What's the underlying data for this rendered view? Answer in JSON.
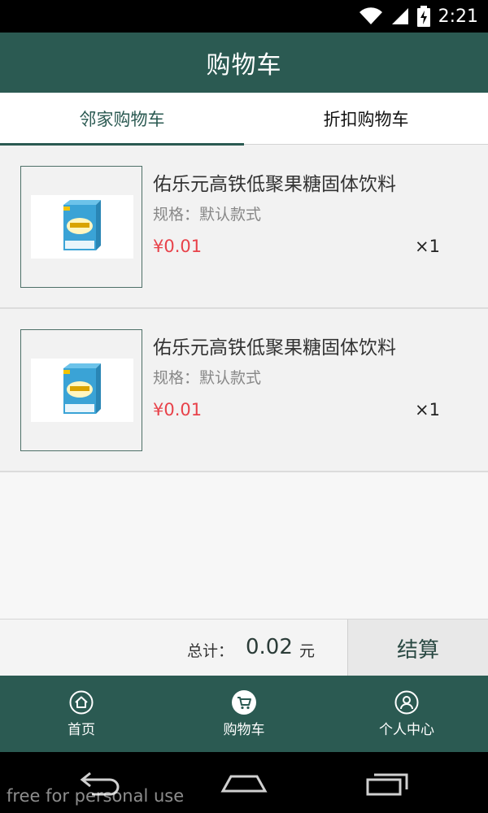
{
  "status_bar": {
    "time": "2:21"
  },
  "header": {
    "title": "购物车"
  },
  "tabs": [
    {
      "label": "邻家购物车",
      "active": true
    },
    {
      "label": "折扣购物车",
      "active": false
    }
  ],
  "cart": {
    "items": [
      {
        "name": "佑乐元高铁低聚果糖固体饮料",
        "spec": "规格：默认款式",
        "price": "¥0.01",
        "qty": "×1"
      },
      {
        "name": "佑乐元高铁低聚果糖固体饮料",
        "spec": "规格：默认款式",
        "price": "¥0.01",
        "qty": "×1"
      }
    ]
  },
  "footer": {
    "total_label": "总计：",
    "total_value": "0.02",
    "total_unit": "元",
    "checkout_label": "结算"
  },
  "bottom_nav": [
    {
      "label": "首页",
      "icon": "home-icon"
    },
    {
      "label": "购物车",
      "icon": "cart-icon"
    },
    {
      "label": "个人中心",
      "icon": "user-icon"
    }
  ],
  "watermark": "free for personal use",
  "colors": {
    "primary": "#2b5a52",
    "price": "#e8424a"
  }
}
